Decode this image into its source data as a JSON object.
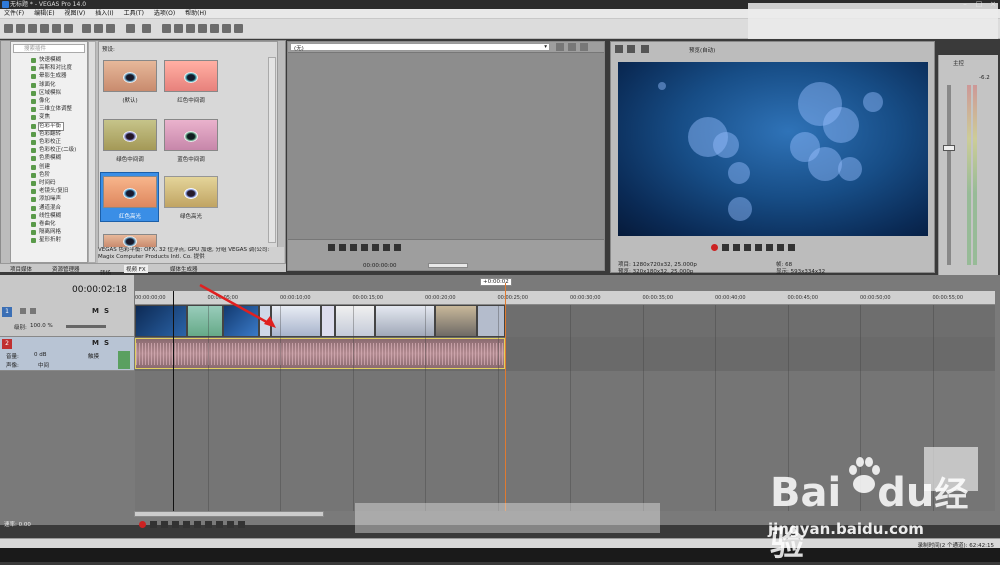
{
  "window": {
    "title": "无标题 * - VEGAS Pro 14.0"
  },
  "menu": [
    "文件(F)",
    "编辑(E)",
    "视图(V)",
    "插入(I)",
    "工具(T)",
    "选项(O)",
    "帮助(H)"
  ],
  "tree": {
    "search_placeholder": "搜索插件",
    "items": [
      "快速模糊",
      "高斯和对比度",
      "晕影生成器",
      "球面化",
      "区域模拟",
      "像化",
      "三维立体调整",
      "变焦",
      "色彩平衡",
      "色彩翻转",
      "色彩校正",
      "色彩校正(二级)",
      "色质模糊",
      "创建",
      "色阶",
      "时间码",
      "老镜头/复旧",
      "添加噪声",
      "通道混合",
      "线性模糊",
      "卷曲化",
      "隔离网格",
      "星形折射"
    ],
    "selected_index": 8
  },
  "fx_panel": {
    "header": "预设:",
    "presets": [
      "(默认)",
      "红色中间调",
      "绿色中间调",
      "蓝色中间调",
      "红色高光",
      "绿色高光"
    ],
    "selected_index": 4,
    "description": "VEGAS 色彩平衡: OFX, 32 位浮点, GPU 加速, 分组 VEGAS 调(公司: Magix Computer Products Intl. Co. 提供",
    "tabs": [
      "项目媒体",
      "资源管理器",
      "转场",
      "视频 FX",
      "媒体生成器"
    ]
  },
  "trimmer": {
    "dropdown": "(无)",
    "timecode": "00:00:00:00"
  },
  "preview": {
    "mode": "预览(自动)",
    "project_label": "项目:",
    "project_value": "1280x720x32, 25.000p",
    "preview_label": "预览:",
    "preview_value": "320x180x32, 25.000p",
    "frame_label": "帧:",
    "frame_value": "68",
    "display_label": "显示:",
    "display_value": "593x334x32"
  },
  "master": {
    "label": "主控",
    "value": "-6.2"
  },
  "timeline": {
    "current_time": "00:00:02:18",
    "end_marker": "+0:00:02",
    "ticks": [
      "00:00:00;00",
      "00:00:05;00",
      "00:00:10;00",
      "00:00:15;00",
      "00:00:20;00",
      "00:00:25;00",
      "00:00:30;00",
      "00:00:35;00",
      "00:00:40;00",
      "00:00:45;00",
      "00:00:50;00",
      "00:00:55;00"
    ],
    "video_track": {
      "number": "1",
      "level_label": "级别:",
      "level_value": "100.0 %"
    },
    "audio_track": {
      "number": "2",
      "volume_label": "音量:",
      "volume_value": "0 dB",
      "pan_label": "声像:",
      "pan_value": "中间",
      "mode": "触摸"
    }
  },
  "status": {
    "rate_label": "速率:",
    "rate_value": "0.00",
    "record_time": "录制时间(2 个通道): 62:42:15"
  },
  "watermark": {
    "brand_a": "Bai",
    "brand_b": "du",
    "brand_cn": "经验",
    "url": "jingyan.baidu.com"
  }
}
